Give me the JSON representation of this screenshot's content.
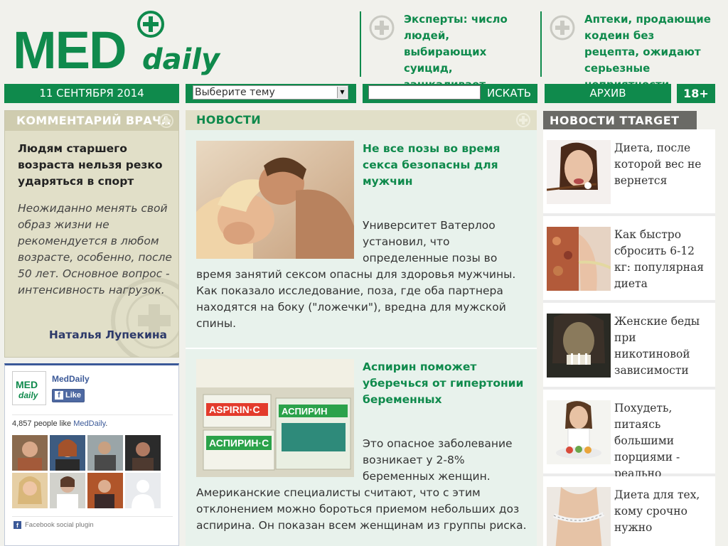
{
  "brand": {
    "logo_main": "MED",
    "logo_sub": "daily"
  },
  "header_news": [
    {
      "text": "Эксперты: число людей, выбирающих суицид, зашкаливает"
    },
    {
      "text": "Аптеки, продающие кодеин без рецепта, ожидают серьезные неприятности"
    }
  ],
  "nav": {
    "date": "11 СЕНТЯБРЯ 2014",
    "topic_select": "Выберите тему",
    "search_value": "",
    "search_button": "ИСКАТЬ",
    "archive": "АРХИВ",
    "age": "18+"
  },
  "doctor_comment": {
    "heading": "КОММЕНТАРИЙ ВРАЧА",
    "title": "Людям старшего возраста нельзя резко ударяться в спорт",
    "text": "Неожиданно менять свой образ жизни не рекомендуется в любом возрасте, особенно, после 50 лет. Основное вопрос - интенсивность нагрузок.",
    "author": "Наталья Лупекина"
  },
  "facebook": {
    "logo_main": "MED",
    "logo_sub": "daily",
    "page_name": "MedDaily",
    "like_label": "Like",
    "count_text": "4,857 people like",
    "count_link": "MedDaily",
    "count_suffix": ".",
    "plugin_label": "Facebook social plugin"
  },
  "news": {
    "heading": "НОВОСТИ",
    "articles": [
      {
        "title": "Не все позы во время секса безопасны для мужчин",
        "body": "Университет Ватерлоо установил, что определенные позы во время занятий сексом опасны для здоровья мужчины. Как показало исследование, поза, где оба партнера находятся на боку (\"ложечки\"), вредна для мужской спины."
      },
      {
        "title": "Аспирин поможет уберечься от гипертонии беременных",
        "body": "Это опасное заболевание возникает у 2-8% беременных женщин. Американские специалисты считают, что с этим отклонением можно бороться приемом небольших доз аспирина. Он показан всем женщинам из группы риска."
      }
    ],
    "image_labels": {
      "aspirin1": "ASPIRIN·C",
      "aspirin2": "АСПИРИН·С",
      "aspirin3": "АСПИРИН"
    }
  },
  "ttarget": {
    "heading": "НОВОСТИ TTARGET",
    "items": [
      {
        "text": "Диета, после которой вес не вернется"
      },
      {
        "text": "Как быстро сбросить 6-12 кг: популярная диета"
      },
      {
        "text": "Женские беды при никотиновой зависимости"
      },
      {
        "text": "Похудеть, питаясь большими порциями - реально"
      },
      {
        "text": "Диета для тех, кому срочно нужно"
      }
    ]
  }
}
